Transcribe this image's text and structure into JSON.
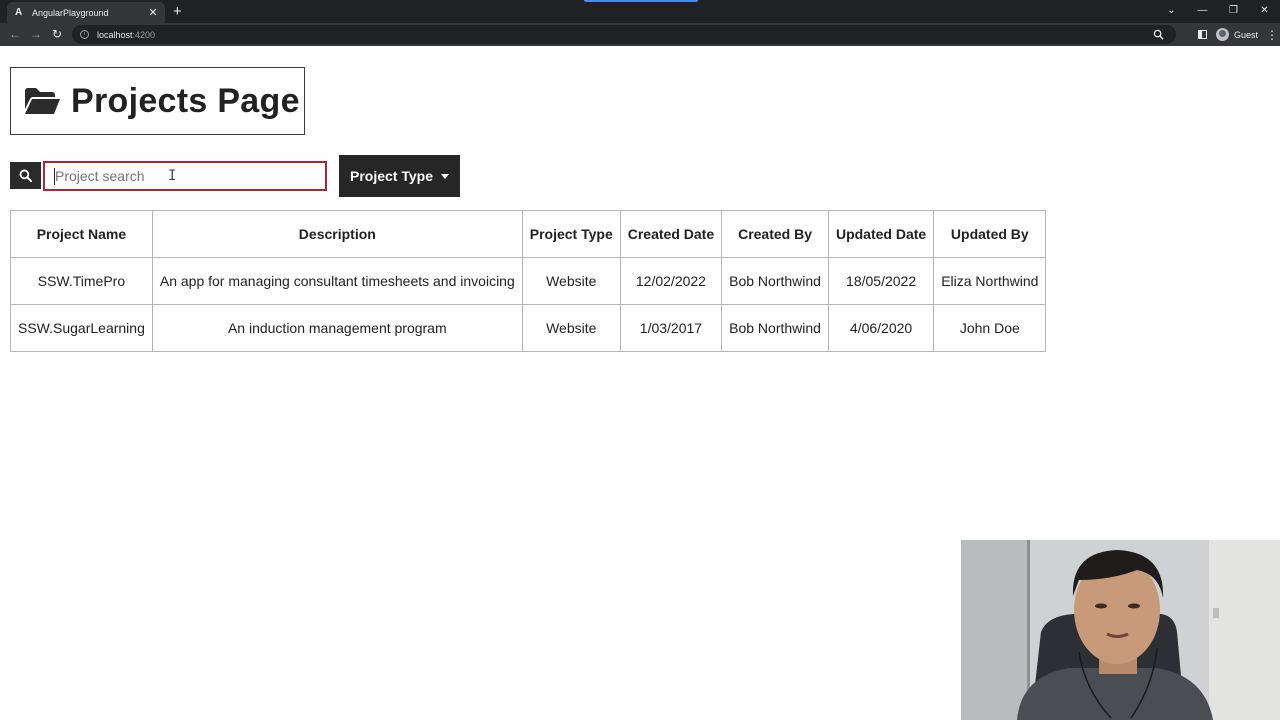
{
  "browser": {
    "tab_icon": "A",
    "tab_title": "AngularPlayground",
    "tab_close": "✕",
    "new_tab": "+",
    "url_host": "localhost",
    "url_port": ":4200",
    "profile_name": "Guest"
  },
  "page": {
    "title": "Projects Page",
    "search": {
      "placeholder": "Project search",
      "value": ""
    },
    "filter_button": "Project Type"
  },
  "table": {
    "headers": [
      "Project Name",
      "Description",
      "Project Type",
      "Created Date",
      "Created By",
      "Updated Date",
      "Updated By"
    ],
    "rows": [
      [
        "SSW.TimePro",
        "An app for managing consultant timesheets and invoicing",
        "Website",
        "12/02/2022",
        "Bob Northwind",
        "18/05/2022",
        "Eliza Northwind"
      ],
      [
        "SSW.SugarLearning",
        "An induction management program",
        "Website",
        "1/03/2017",
        "Bob Northwind",
        "4/06/2020",
        "John Doe"
      ]
    ]
  },
  "icons": {
    "folder": "folder-open-icon",
    "search": "search-icon",
    "dropdown": "caret-down-icon"
  },
  "colors": {
    "accent_border": "#b22234",
    "dark_button": "#262626",
    "browser_frame": "#202124"
  }
}
